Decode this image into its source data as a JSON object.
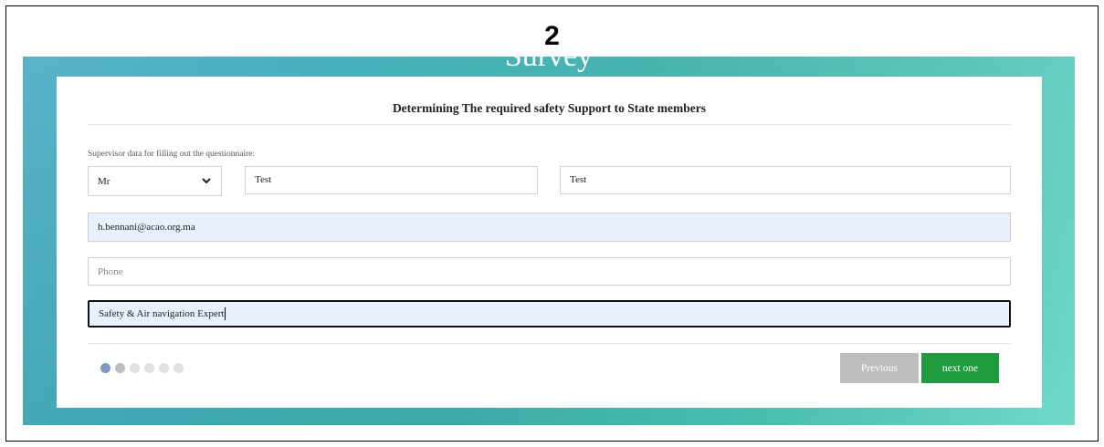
{
  "step_number": "2",
  "banner": {
    "title": "Survey"
  },
  "form": {
    "title": "Determining The required safety Support to State members",
    "section_label": "Supervisor data for filling out the questionnaire:",
    "title_select": {
      "value": "Mr"
    },
    "first_name": {
      "value": "Test"
    },
    "last_name": {
      "value": "Test"
    },
    "email": {
      "value": "h.bennani@acao.org.ma"
    },
    "phone": {
      "placeholder": "Phone",
      "value": ""
    },
    "job_title": {
      "value": "Safety & Air navigation Expert"
    }
  },
  "progress": {
    "total_steps": 6,
    "current_step": 2
  },
  "buttons": {
    "previous": "Previous",
    "next": "next one"
  },
  "colors": {
    "banner_gradient_start": "#5ab3c9",
    "banner_gradient_end": "#72d9c7",
    "next_button": "#1f9a3e",
    "previous_button": "#bdbdbd",
    "autofill_background": "#e8f0fe",
    "active_dot": "#7f98c4"
  }
}
